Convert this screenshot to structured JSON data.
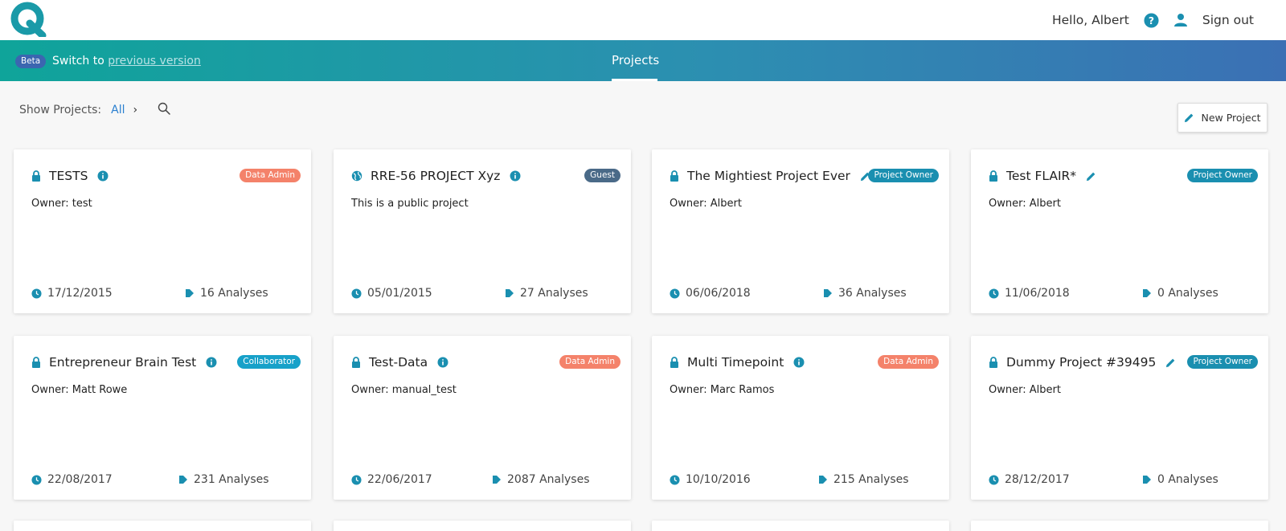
{
  "header": {
    "greeting": "Hello, Albert",
    "sign_out": "Sign out"
  },
  "banner": {
    "beta": "Beta",
    "switch_prefix": "Switch to",
    "switch_link": "previous version",
    "active_tab": "Projects"
  },
  "filter": {
    "label": "Show Projects:",
    "value": "All"
  },
  "new_project_label": "New Project",
  "colors": {
    "accent": "#1a8fb0",
    "badge_admin": "#f4826a",
    "badge_guest": "#4a6a88",
    "badge_owner": "#1a8fb0",
    "badge_collab": "#17a1c9"
  },
  "cards": [
    {
      "title": "TESTS",
      "lead_icon": "lock-icon",
      "trail_icon": "info-icon",
      "badge": "Data Admin",
      "desc": "Owner: test",
      "date": "17/12/2015",
      "analyses": "16 Analyses"
    },
    {
      "title": "RRE-56 PROJECT Xyz",
      "lead_icon": "globe-icon",
      "trail_icon": "info-icon",
      "badge": "Guest",
      "desc": "This is a public project",
      "date": "05/01/2015",
      "analyses": "27 Analyses"
    },
    {
      "title": "The Mightiest Project Ever",
      "lead_icon": "lock-icon",
      "trail_icon": "pencil-icon",
      "badge": "Project Owner",
      "desc": "Owner: Albert",
      "date": "06/06/2018",
      "analyses": "36 Analyses"
    },
    {
      "title": "Test FLAIR*",
      "lead_icon": "lock-icon",
      "trail_icon": "pencil-icon",
      "badge": "Project Owner",
      "desc": "Owner: Albert",
      "date": "11/06/2018",
      "analyses": "0 Analyses"
    },
    {
      "title": "Entrepreneur Brain Test",
      "lead_icon": "lock-icon",
      "trail_icon": "info-icon",
      "badge": "Collaborator",
      "desc": "Owner: Matt Rowe",
      "date": "22/08/2017",
      "analyses": "231 Analyses"
    },
    {
      "title": "Test-Data",
      "lead_icon": "lock-icon",
      "trail_icon": "info-icon",
      "badge": "Data Admin",
      "desc": "Owner: manual_test",
      "date": "22/06/2017",
      "analyses": "2087 Analyses"
    },
    {
      "title": "Multi Timepoint",
      "lead_icon": "lock-icon",
      "trail_icon": "info-icon",
      "badge": "Data Admin",
      "desc": "Owner: Marc Ramos",
      "date": "10/10/2016",
      "analyses": "215 Analyses"
    },
    {
      "title": "Dummy Project #39495",
      "lead_icon": "lock-icon",
      "trail_icon": "pencil-icon",
      "badge": "Project Owner",
      "desc": "Owner: Albert",
      "date": "28/12/2017",
      "analyses": "0 Analyses"
    }
  ]
}
